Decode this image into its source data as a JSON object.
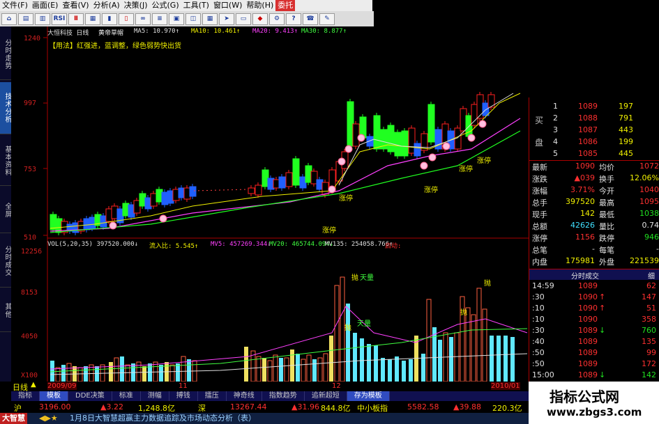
{
  "menu": [
    {
      "label": "文件(F)"
    },
    {
      "label": "画面(E)"
    },
    {
      "label": "查看(V)"
    },
    {
      "label": "分析(A)"
    },
    {
      "label": "决策(J)"
    },
    {
      "label": "公式(G)"
    },
    {
      "label": "工具(T)"
    },
    {
      "label": "窗口(W)"
    },
    {
      "label": "帮助(H)"
    },
    {
      "label": "委托"
    }
  ],
  "toolbar": {
    "rsi_label": "RSI"
  },
  "left_tabs": [
    "分时走势",
    "技术分析",
    "基本资料",
    "全屏",
    "分时成交",
    "其他"
  ],
  "chart": {
    "stock_title": "大恒科技 日线",
    "formula_name": "黄帝草帽",
    "ma_readout": [
      {
        "text": "MA5: 10.970↑",
        "color": "#e0e0e0"
      },
      {
        "text": "MA10: 10.461↑",
        "color": "#f0f000"
      },
      {
        "text": "MA20: 9.413↑",
        "color": "#ff40ff"
      },
      {
        "text": "MA30: 8.877↑",
        "color": "#40ff40"
      }
    ],
    "usage": "【用法】红强进，蓝调整，绿色弱势快出货",
    "price_axis": [
      "1240",
      "997",
      "753",
      "510"
    ],
    "vol_axis": [
      "12256",
      "8153",
      "4050",
      "X100"
    ],
    "vol_readout": [
      {
        "text": "VOL(5,20,35) 397520.000↓",
        "color": "#e0e0e0"
      },
      {
        "text": "流入比: 5.545↑",
        "color": "#f0f000"
      },
      {
        "text": "MV5: 457269.344↓",
        "color": "#ff40ff"
      },
      {
        "text": "MV20: 465744.094↓",
        "color": "#40ff40"
      },
      {
        "text": "MV135: 254058.766↑",
        "color": "#e0e0e0"
      },
      {
        "text": "启动:",
        "color": "#ff3030"
      }
    ],
    "annotations": {
      "zt1": "涨停",
      "zt2": "涨停",
      "zt3": "涨停",
      "zt4": "涨停",
      "zt5": "涨停",
      "tian1": "天量",
      "tian2": "天量",
      "pao1": "抛",
      "pao2": "抛",
      "pao3": "抛",
      "pao4": "抛"
    },
    "date_axis": {
      "period_label": "日线",
      "start": "2009/09",
      "m1": "11",
      "m2": "12",
      "end": "2010/01"
    }
  },
  "quote": {
    "buy_label": "买",
    "pan_label": "盘",
    "buy_levels": [
      {
        "n": "1",
        "price": "1089",
        "vol": "197"
      },
      {
        "n": "2",
        "price": "1088",
        "vol": "791"
      },
      {
        "n": "3",
        "price": "1087",
        "vol": "443"
      },
      {
        "n": "4",
        "price": "1086",
        "vol": "199"
      },
      {
        "n": "5",
        "price": "1085",
        "vol": "445"
      }
    ],
    "stats": [
      {
        "l1": "最新",
        "v1": "1090",
        "l2": "均价",
        "v2": "1072"
      },
      {
        "l1": "涨跌",
        "v1": "▲039",
        "l2": "换手",
        "v2": "12.06%"
      },
      {
        "l1": "涨幅",
        "v1": "3.71%",
        "l2": "今开",
        "v2": "1040"
      },
      {
        "l1": "总手",
        "v1": "397520",
        "l2": "最高",
        "v2": "1095"
      },
      {
        "l1": "现手",
        "v1": "142",
        "l2": "最低",
        "v2": "1038"
      },
      {
        "l1": "总额",
        "v1": "42626",
        "l2": "量比",
        "v2": "0.74"
      },
      {
        "l1": "涨停",
        "v1": "1156",
        "l2": "跌停",
        "v2": "946"
      },
      {
        "l1": "总笔",
        "v1": "-",
        "l2": "每笔",
        "v2": "-"
      },
      {
        "l1": "内盘",
        "v1": "175981",
        "l2": "外盘",
        "v2": "221539"
      }
    ],
    "trades_title": "分时成交",
    "trades_btn": "细",
    "trades": [
      {
        "time": "14:59",
        "price": "1089",
        "arrow": "",
        "vol": "62",
        "vc": "red"
      },
      {
        "time": ":30",
        "price": "1090",
        "arrow": "↑",
        "vol": "147",
        "vc": "red"
      },
      {
        "time": ":10",
        "price": "1090",
        "arrow": "↑",
        "vol": "51",
        "vc": "red"
      },
      {
        "time": ":10",
        "price": "1090",
        "arrow": "",
        "vol": "358",
        "vc": "red"
      },
      {
        "time": ":30",
        "price": "1089",
        "arrow": "↓",
        "vol": "760",
        "vc": "grn"
      },
      {
        "time": ":40",
        "price": "1089",
        "arrow": "",
        "vol": "135",
        "vc": "red"
      },
      {
        "time": ":50",
        "price": "1089",
        "arrow": "",
        "vol": "99",
        "vc": "red"
      },
      {
        "time": ":50",
        "price": "1089",
        "arrow": "",
        "vol": "172",
        "vc": "red"
      },
      {
        "time": "15:00",
        "price": "1089",
        "arrow": "↓",
        "vol": "142",
        "vc": "grn"
      }
    ]
  },
  "bottom_tabs": [
    "指标",
    "模板",
    "DDE决策",
    "标准",
    "测幅",
    "搏钱",
    "擂压",
    "神奇线",
    "指数趋势",
    "追新超短",
    "存为模板"
  ],
  "index_row": {
    "sh": "沪",
    "sh_val": "3196.00",
    "sh_chg": "▲3.22",
    "sh_amt": "1,248.8亿",
    "sz": "深",
    "sz_val": "13267.44",
    "sz_chg": "▲31.96",
    "sz_amt": "844.8亿",
    "zxb": "中小板指",
    "zxb_val": "5582.58",
    "zxb_chg": "▲39.88",
    "zxb_amt": "220.3亿"
  },
  "status": {
    "logo": "大智慧",
    "text": "1月8日大智慧超赢主力数据追踪及市场动态分析（表）"
  },
  "watermark": {
    "line1": "指标公式网",
    "line2": "www.zbgs3.com"
  }
}
